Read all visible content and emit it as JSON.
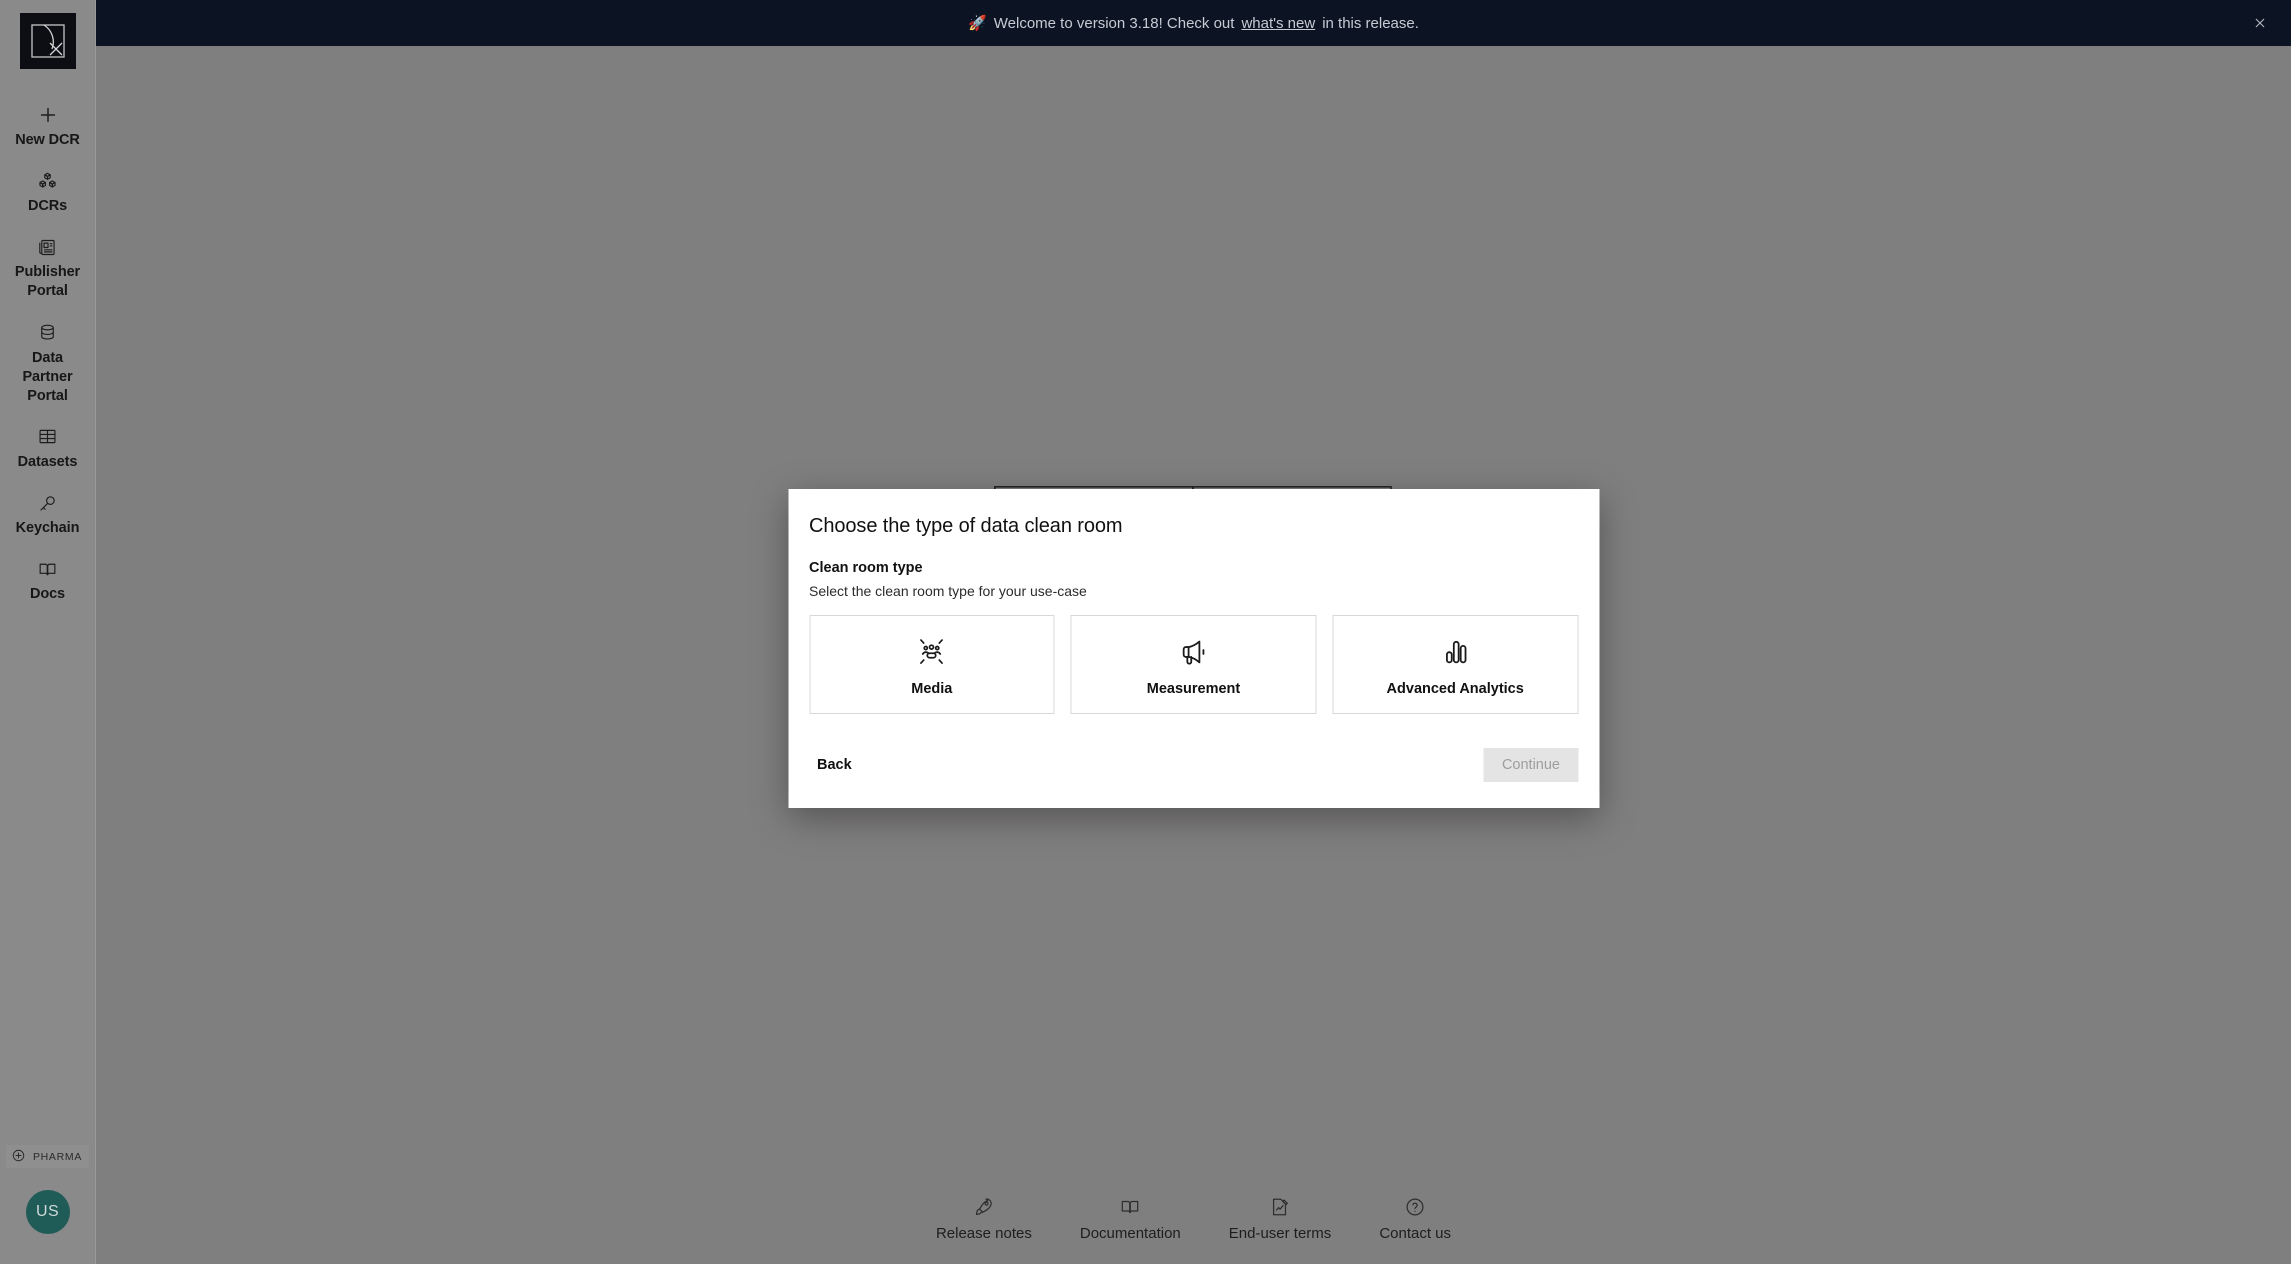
{
  "app": {
    "logo_alt": "decentriq-logo"
  },
  "banner": {
    "emoji": "🚀",
    "prefix": "Welcome to version 3.18! Check out",
    "link": "what's new",
    "suffix": "in this release.",
    "close_label": "×",
    "background": "#0c1322",
    "text_color": "#c7cbd4"
  },
  "sidebar": {
    "items": [
      {
        "label": "New DCR",
        "icon": "plus-icon"
      },
      {
        "label": "DCRs",
        "icon": "cubes-icon"
      },
      {
        "label": "Publisher Portal",
        "icon": "newspaper-icon"
      },
      {
        "label": "Data Partner Portal",
        "icon": "database-icon"
      },
      {
        "label": "Datasets",
        "icon": "table-icon"
      },
      {
        "label": "Keychain",
        "icon": "key-icon"
      },
      {
        "label": "Docs",
        "icon": "book-icon"
      }
    ],
    "badge": {
      "label": "PHARMA",
      "icon": "circle-plus-icon"
    },
    "avatar": {
      "initials": "US",
      "color": "#1f5b57"
    }
  },
  "modal": {
    "title": "Choose the type of data clean room",
    "section_title": "Clean room type",
    "section_subtitle": "Select the clean room type for your use-case",
    "cards": [
      {
        "label": "Media",
        "icon": "people-burst-icon"
      },
      {
        "label": "Measurement",
        "icon": "megaphone-icon"
      },
      {
        "label": "Advanced Analytics",
        "icon": "bar-chart-icon"
      }
    ],
    "back_label": "Back",
    "continue_label": "Continue",
    "continue_disabled": true
  },
  "footer": {
    "items": [
      {
        "label": "Release notes",
        "icon": "rocket-icon"
      },
      {
        "label": "Documentation",
        "icon": "book-icon"
      },
      {
        "label": "End-user terms",
        "icon": "signed-doc-icon"
      },
      {
        "label": "Contact us",
        "icon": "question-circle-icon"
      }
    ]
  },
  "theme": {
    "page_background": "#807f7f",
    "sidebar_background": "#8a8a8a",
    "modal_background": "#ffffff",
    "card_border": "#d8d8d8",
    "disabled_button": "#e4e4e4"
  }
}
